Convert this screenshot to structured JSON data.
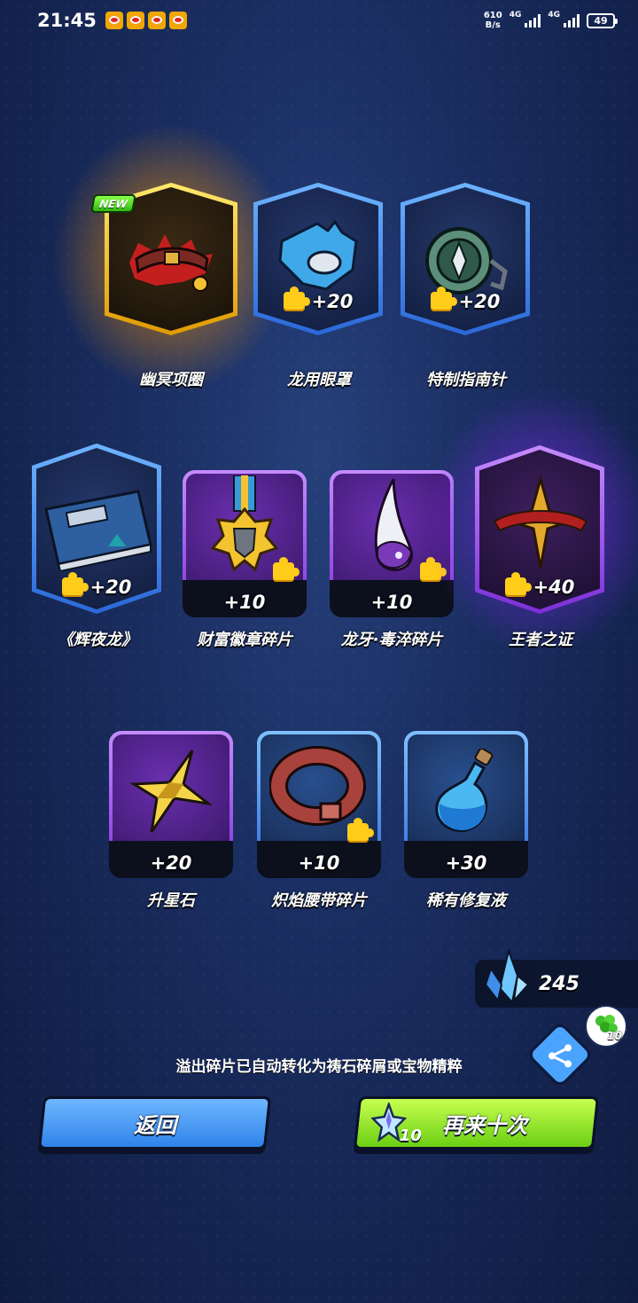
{
  "status_bar": {
    "time": "21:45",
    "net_speed_value": "610",
    "net_speed_unit": "B/s",
    "network_type_1": "4G",
    "network_type_2": "4G",
    "battery": "49"
  },
  "rewards": [
    {
      "name": "幽冥项圈",
      "badge": "NEW",
      "frame": "gold-hex",
      "quantity": ""
    },
    {
      "name": "龙用眼罩",
      "frame": "blue-hex",
      "quantity": "+20",
      "fragment": true
    },
    {
      "name": "特制指南针",
      "frame": "blue-hex",
      "quantity": "+20",
      "fragment": true
    },
    {
      "name": "《辉夜龙》",
      "frame": "blue-hex",
      "quantity": "+20",
      "fragment": true
    },
    {
      "name": "财富徽章碎片",
      "frame": "purple-square",
      "quantity": "+10",
      "fragment": true
    },
    {
      "name": "龙牙·毒淬碎片",
      "frame": "purple-square",
      "quantity": "+10",
      "fragment": true
    },
    {
      "name": "王者之证",
      "frame": "purple-hex",
      "quantity": "+40",
      "fragment": true
    },
    {
      "name": "升星石",
      "frame": "purple-square",
      "quantity": "+20",
      "fragment": false
    },
    {
      "name": "炽焰腰带碎片",
      "frame": "blue-square",
      "quantity": "+10",
      "fragment": true
    },
    {
      "name": "稀有修复液",
      "frame": "blue-square",
      "quantity": "+30",
      "fragment": false
    }
  ],
  "currency": {
    "crystals": "245",
    "clover_count": "10"
  },
  "notice": "溢出碎片已自动转化为祷石碎屑或宝物精粹",
  "buttons": {
    "back_label": "返回",
    "again_label": "再来十次",
    "again_cost": "10"
  },
  "colors": {
    "background": "#1b2f63",
    "gold_frame": "#ffcc1a",
    "blue_frame": "#4a8cf0",
    "purple_frame": "#a05ef0",
    "back_button": "#3d92f0",
    "again_button": "#8ee020",
    "fragment_icon": "#ffcc1a"
  },
  "icons": [
    "weibo-icon",
    "signal-icon",
    "battery-icon",
    "puzzle-fragment-icon",
    "crystal-icon",
    "share-icon",
    "clover-icon",
    "star-crystal-icon"
  ]
}
